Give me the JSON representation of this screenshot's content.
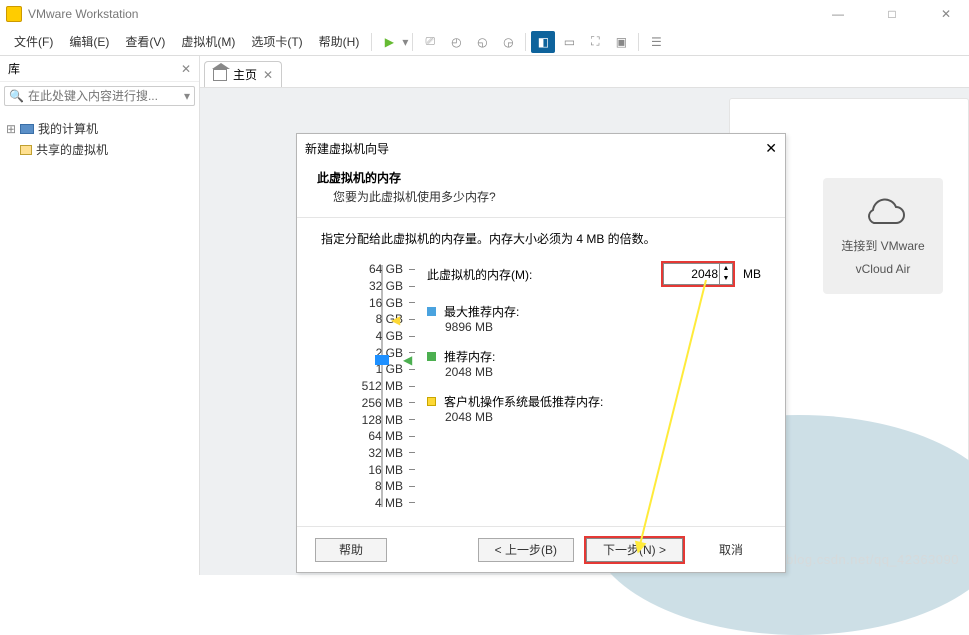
{
  "window": {
    "title": "VMware Workstation"
  },
  "menus": {
    "file": "文件(F)",
    "edit": "编辑(E)",
    "view": "查看(V)",
    "vm": "虚拟机(M)",
    "tabs": "选项卡(T)",
    "help": "帮助(H)"
  },
  "sidebar": {
    "title": "库",
    "search_placeholder": "在此处键入内容进行搜...",
    "items": [
      {
        "label": "我的计算机"
      },
      {
        "label": "共享的虚拟机"
      }
    ]
  },
  "tab": {
    "home": "主页"
  },
  "vcloud": {
    "line1": "连接到 VMware",
    "line2": "vCloud Air"
  },
  "wizard": {
    "title": "新建虚拟机向导",
    "heading": "此虚拟机的内存",
    "sub": "您要为此虚拟机使用多少内存?",
    "note": "指定分配给此虚拟机的内存量。内存大小必须为 4 MB 的倍数。",
    "mem_label": "此虚拟机的内存(M):",
    "mem_value": "2048",
    "mem_unit": "MB",
    "ticks": [
      "64 GB",
      "32 GB",
      "16 GB",
      "8 GB",
      "4 GB",
      "2 GB",
      "1 GB",
      "512 MB",
      "256 MB",
      "128 MB",
      "64 MB",
      "32 MB",
      "16 MB",
      "8 MB",
      "4 MB"
    ],
    "rec_max_label": "最大推荐内存:",
    "rec_max_val": "9896 MB",
    "rec_label": "推荐内存:",
    "rec_val": "2048 MB",
    "rec_min_label": "客户机操作系统最低推荐内存:",
    "rec_min_val": "2048 MB",
    "btn_help": "帮助",
    "btn_back": "< 上一步(B)",
    "btn_next": "下一步(N) >",
    "btn_cancel": "取消"
  },
  "watermark": "https://blog.csdn.net/qq_42363090"
}
